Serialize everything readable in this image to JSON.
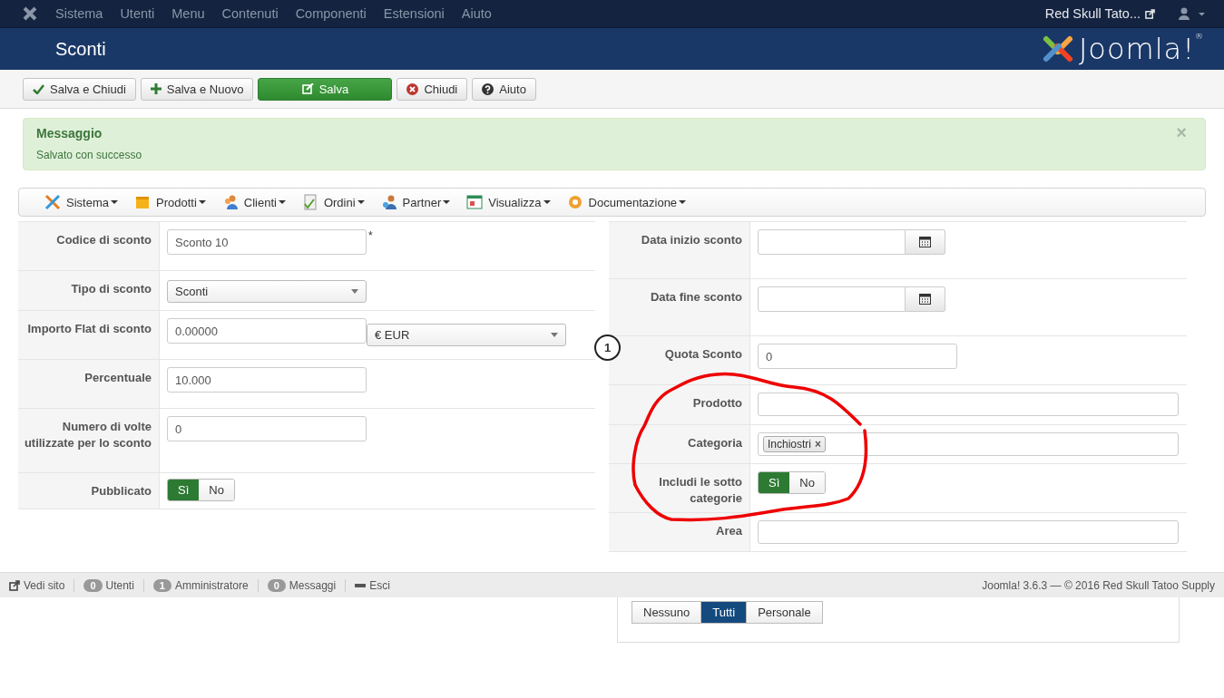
{
  "top_menu": {
    "items": [
      "Sistema",
      "Utenti",
      "Menu",
      "Contenuti",
      "Componenti",
      "Estensioni",
      "Aiuto"
    ],
    "site_link": "Red Skull Tato..."
  },
  "header": {
    "title": "Sconti",
    "logo_text": "Joomla!$^{®}$"
  },
  "toolbar": [
    {
      "label": "Salva e Chiudi",
      "kind": "save-close"
    },
    {
      "label": "Salva e Nuovo",
      "kind": "save-new"
    },
    {
      "label": "Salva",
      "kind": "save"
    },
    {
      "label": "Chiudi",
      "kind": "close"
    },
    {
      "label": "Aiuto",
      "kind": "help"
    }
  ],
  "message": {
    "title": "Messaggio",
    "text": "Salvato con successo",
    "close": "×"
  },
  "component_menu": [
    {
      "label": "Sistema",
      "kind": "tools"
    },
    {
      "label": "Prodotti",
      "kind": "box"
    },
    {
      "label": "Clienti",
      "kind": "users"
    },
    {
      "label": "Ordini",
      "kind": "orders"
    },
    {
      "label": "Partner",
      "kind": "partner"
    },
    {
      "label": "Visualizza",
      "kind": "window"
    },
    {
      "label": "Documentazione",
      "kind": "help"
    }
  ],
  "left_fields": [
    {
      "label": "Codice di sconto",
      "kind": "text",
      "value": "Sconto 10",
      "required_mark": "*"
    },
    {
      "label": "Tipo di sconto",
      "kind": "select",
      "value": "Sconti"
    },
    {
      "label": "Importo Flat di sconto",
      "kind": "text-select",
      "value": "0.00000",
      "select": "€ EUR"
    },
    {
      "label": "Percentuale",
      "kind": "text",
      "value": "10.000"
    },
    {
      "label": "Numero di volte utilizzate per lo sconto",
      "kind": "text",
      "value": "0"
    },
    {
      "label": "Pubblicato",
      "kind": "toggle",
      "options": [
        {
          "label": "Sì",
          "selected": true
        },
        {
          "label": "No",
          "selected": false
        }
      ]
    }
  ],
  "right_fields": [
    {
      "label": "Data inizio sconto",
      "kind": "date"
    },
    {
      "label": "Data fine sconto",
      "kind": "date"
    },
    {
      "label": "Quota Sconto",
      "kind": "text",
      "value": "0"
    },
    {
      "label": "Prodotto",
      "kind": "wide"
    },
    {
      "label": "Categoria",
      "kind": "tags",
      "tags": [
        "Inchiostri"
      ],
      "remove": "×"
    },
    {
      "label": "Includi le sotto categorie",
      "kind": "toggle",
      "options": [
        {
          "label": "Sì",
          "selected": true
        },
        {
          "label": "No",
          "selected": false
        }
      ]
    },
    {
      "label": "Area",
      "kind": "wide"
    }
  ],
  "access_level": {
    "options": [
      {
        "label": "Nessuno",
        "selected": false
      },
      {
        "label": "Tutti",
        "selected": true
      },
      {
        "label": "Personale",
        "selected": false
      }
    ]
  },
  "annotation": {
    "marker": "1"
  },
  "status_bar": {
    "items": [
      {
        "kind": "link",
        "label": "Vedi sito"
      },
      {
        "kind": "count",
        "count": "0",
        "label": "Utenti"
      },
      {
        "kind": "count",
        "count": "1",
        "label": "Amministratore"
      },
      {
        "kind": "count",
        "count": "0",
        "label": "Messaggi"
      },
      {
        "kind": "logout",
        "label": "Esci"
      }
    ],
    "copyright": "Joomla! 3.6.3 — © 2016 Red Skull Tatoo Supply"
  }
}
